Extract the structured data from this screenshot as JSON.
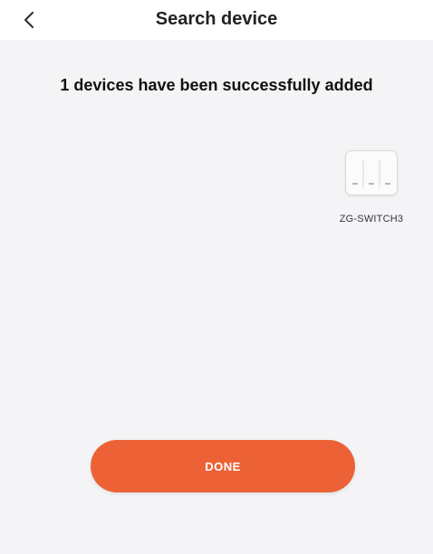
{
  "header": {
    "title": "Search device",
    "back_icon": "chevron-left-icon"
  },
  "message": "1 devices have been successfully added",
  "devices": [
    {
      "name": "ZG-SWITCH3",
      "icon": "three-gang-switch-icon"
    }
  ],
  "footer": {
    "done_label": "DONE"
  },
  "colors": {
    "accent": "#ec6236",
    "background": "#f4f4f6",
    "header_background": "#ffffff"
  }
}
